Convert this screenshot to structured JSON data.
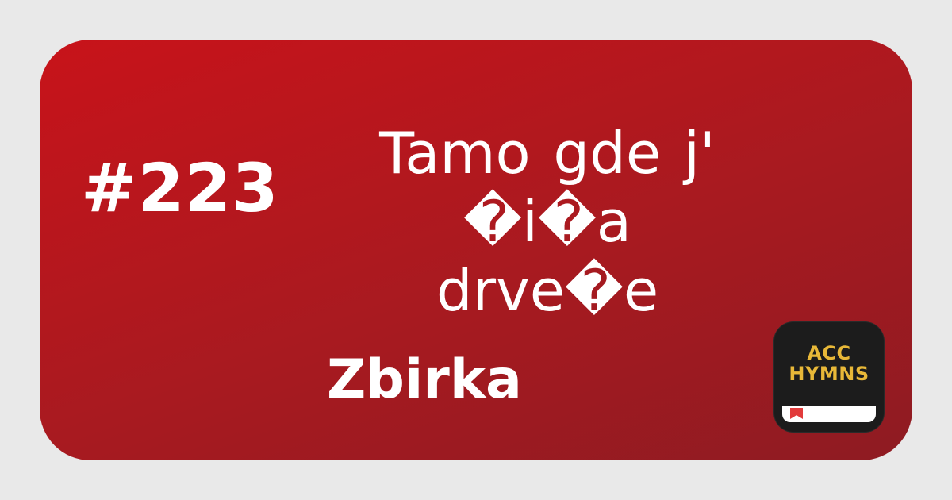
{
  "hymn": {
    "number": "#223",
    "title_line1": "Tamo  gde j' �i�a",
    "title_line2": "drve�e",
    "collection": "Zbirka"
  },
  "app_icon": {
    "line1": "ACC",
    "line2": "HYMNS",
    "icon": "book-icon",
    "text_color": "#e8b838",
    "background": "#1c1c1c"
  },
  "colors": {
    "card_gradient_start": "#c8131a",
    "card_gradient_end": "#8e1b22",
    "frame": "#e9e9e9",
    "text": "#ffffff"
  }
}
